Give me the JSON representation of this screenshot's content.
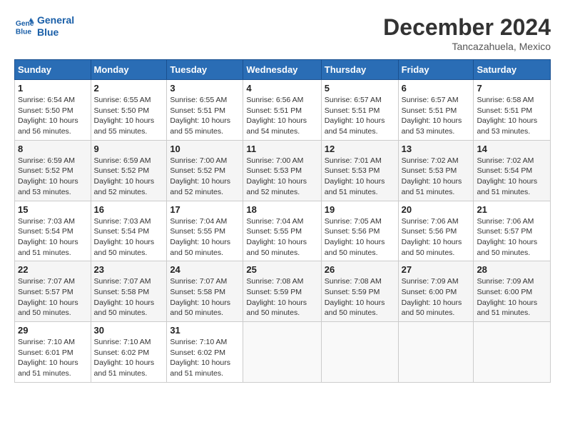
{
  "logo": {
    "line1": "General",
    "line2": "Blue"
  },
  "title": "December 2024",
  "location": "Tancazahuela, Mexico",
  "days_header": [
    "Sunday",
    "Monday",
    "Tuesday",
    "Wednesday",
    "Thursday",
    "Friday",
    "Saturday"
  ],
  "weeks": [
    [
      {
        "num": "1",
        "sunrise": "6:54 AM",
        "sunset": "5:50 PM",
        "daylight": "10 hours and 56 minutes."
      },
      {
        "num": "2",
        "sunrise": "6:55 AM",
        "sunset": "5:50 PM",
        "daylight": "10 hours and 55 minutes."
      },
      {
        "num": "3",
        "sunrise": "6:55 AM",
        "sunset": "5:51 PM",
        "daylight": "10 hours and 55 minutes."
      },
      {
        "num": "4",
        "sunrise": "6:56 AM",
        "sunset": "5:51 PM",
        "daylight": "10 hours and 54 minutes."
      },
      {
        "num": "5",
        "sunrise": "6:57 AM",
        "sunset": "5:51 PM",
        "daylight": "10 hours and 54 minutes."
      },
      {
        "num": "6",
        "sunrise": "6:57 AM",
        "sunset": "5:51 PM",
        "daylight": "10 hours and 53 minutes."
      },
      {
        "num": "7",
        "sunrise": "6:58 AM",
        "sunset": "5:51 PM",
        "daylight": "10 hours and 53 minutes."
      }
    ],
    [
      {
        "num": "8",
        "sunrise": "6:59 AM",
        "sunset": "5:52 PM",
        "daylight": "10 hours and 53 minutes."
      },
      {
        "num": "9",
        "sunrise": "6:59 AM",
        "sunset": "5:52 PM",
        "daylight": "10 hours and 52 minutes."
      },
      {
        "num": "10",
        "sunrise": "7:00 AM",
        "sunset": "5:52 PM",
        "daylight": "10 hours and 52 minutes."
      },
      {
        "num": "11",
        "sunrise": "7:00 AM",
        "sunset": "5:53 PM",
        "daylight": "10 hours and 52 minutes."
      },
      {
        "num": "12",
        "sunrise": "7:01 AM",
        "sunset": "5:53 PM",
        "daylight": "10 hours and 51 minutes."
      },
      {
        "num": "13",
        "sunrise": "7:02 AM",
        "sunset": "5:53 PM",
        "daylight": "10 hours and 51 minutes."
      },
      {
        "num": "14",
        "sunrise": "7:02 AM",
        "sunset": "5:54 PM",
        "daylight": "10 hours and 51 minutes."
      }
    ],
    [
      {
        "num": "15",
        "sunrise": "7:03 AM",
        "sunset": "5:54 PM",
        "daylight": "10 hours and 51 minutes."
      },
      {
        "num": "16",
        "sunrise": "7:03 AM",
        "sunset": "5:54 PM",
        "daylight": "10 hours and 50 minutes."
      },
      {
        "num": "17",
        "sunrise": "7:04 AM",
        "sunset": "5:55 PM",
        "daylight": "10 hours and 50 minutes."
      },
      {
        "num": "18",
        "sunrise": "7:04 AM",
        "sunset": "5:55 PM",
        "daylight": "10 hours and 50 minutes."
      },
      {
        "num": "19",
        "sunrise": "7:05 AM",
        "sunset": "5:56 PM",
        "daylight": "10 hours and 50 minutes."
      },
      {
        "num": "20",
        "sunrise": "7:06 AM",
        "sunset": "5:56 PM",
        "daylight": "10 hours and 50 minutes."
      },
      {
        "num": "21",
        "sunrise": "7:06 AM",
        "sunset": "5:57 PM",
        "daylight": "10 hours and 50 minutes."
      }
    ],
    [
      {
        "num": "22",
        "sunrise": "7:07 AM",
        "sunset": "5:57 PM",
        "daylight": "10 hours and 50 minutes."
      },
      {
        "num": "23",
        "sunrise": "7:07 AM",
        "sunset": "5:58 PM",
        "daylight": "10 hours and 50 minutes."
      },
      {
        "num": "24",
        "sunrise": "7:07 AM",
        "sunset": "5:58 PM",
        "daylight": "10 hours and 50 minutes."
      },
      {
        "num": "25",
        "sunrise": "7:08 AM",
        "sunset": "5:59 PM",
        "daylight": "10 hours and 50 minutes."
      },
      {
        "num": "26",
        "sunrise": "7:08 AM",
        "sunset": "5:59 PM",
        "daylight": "10 hours and 50 minutes."
      },
      {
        "num": "27",
        "sunrise": "7:09 AM",
        "sunset": "6:00 PM",
        "daylight": "10 hours and 50 minutes."
      },
      {
        "num": "28",
        "sunrise": "7:09 AM",
        "sunset": "6:00 PM",
        "daylight": "10 hours and 51 minutes."
      }
    ],
    [
      {
        "num": "29",
        "sunrise": "7:10 AM",
        "sunset": "6:01 PM",
        "daylight": "10 hours and 51 minutes."
      },
      {
        "num": "30",
        "sunrise": "7:10 AM",
        "sunset": "6:02 PM",
        "daylight": "10 hours and 51 minutes."
      },
      {
        "num": "31",
        "sunrise": "7:10 AM",
        "sunset": "6:02 PM",
        "daylight": "10 hours and 51 minutes."
      },
      null,
      null,
      null,
      null
    ]
  ]
}
